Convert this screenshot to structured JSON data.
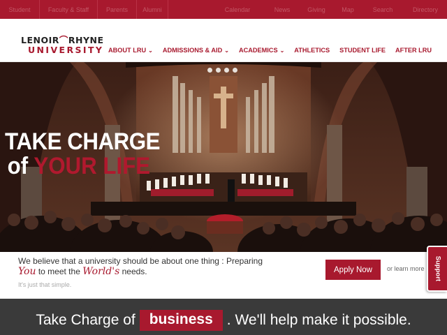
{
  "topbar": {
    "left_links": [
      "Student",
      "Faculty & Staff",
      "Parents",
      "Alumni"
    ],
    "right_links": [
      "Calendar",
      "News",
      "Giving",
      "Map",
      "Search",
      "Directory"
    ]
  },
  "header": {
    "logo": {
      "line1_a": "LENOIR",
      "line1_b": "RHYNE",
      "line2": "UNIVERSITY"
    },
    "nav": [
      {
        "label": "ABOUT LRU",
        "dropdown": true
      },
      {
        "label": "ADMISSIONS & AID",
        "dropdown": true
      },
      {
        "label": "ACADEMICS",
        "dropdown": true
      },
      {
        "label": "ATHLETICS",
        "dropdown": false
      },
      {
        "label": "STUDENT LIFE",
        "dropdown": false
      },
      {
        "label": "AFTER LRU",
        "dropdown": false
      }
    ]
  },
  "hero": {
    "headline_line1": "TAKE CHARGE",
    "headline_of": "of",
    "headline_highlight": "YOUR LIFE",
    "slides": 4,
    "active_slide": 1
  },
  "mission": {
    "text_part1": "We believe that a university should be about one thing : Preparing",
    "script_you": "You",
    "text_part2": "to meet the",
    "script_worlds": "World's",
    "text_part3": "needs.",
    "subtext": "It's just that simple.",
    "apply_label": "Apply Now",
    "learn_label": "or learn more"
  },
  "support": {
    "label": "Support"
  },
  "band": {
    "prefix": "Take Charge of",
    "word": "business",
    "suffix": ". We'll help make it possible."
  },
  "colors": {
    "brand": "#a8192e",
    "band": "#3a3a3a"
  },
  "icons": {
    "nav_dropdown": "chevron-down-icon"
  }
}
